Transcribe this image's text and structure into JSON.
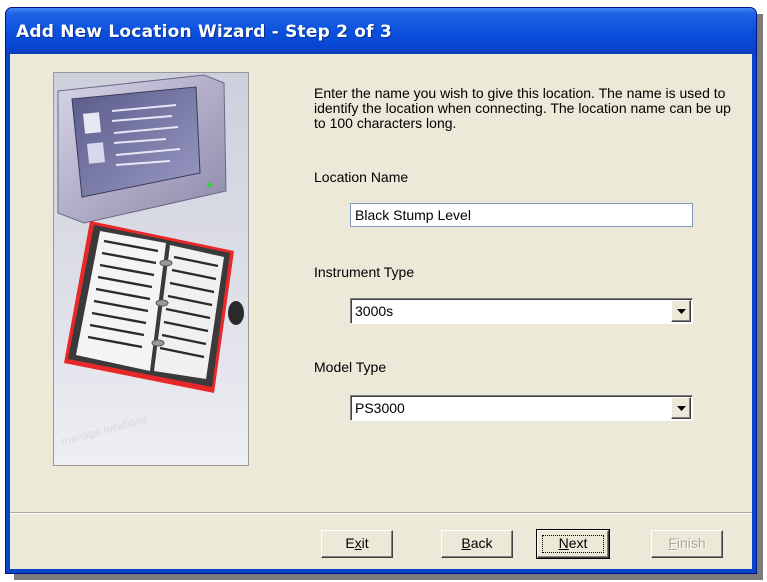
{
  "window": {
    "title": "Add New Location Wizard - Step 2 of 3",
    "colors": {
      "titlebar": "#0a4fdc",
      "client": "#ece9d8",
      "art_accent": "#e02020"
    }
  },
  "description": "Enter the name you wish to give this location. The name is used to identify the location when connecting.  The location name can be up to 100 characters long.",
  "fields": {
    "location_name": {
      "label": "Location Name",
      "value": "Black Stump Level"
    },
    "instrument_type": {
      "label": "Instrument Type",
      "value": "3000s"
    },
    "model_type": {
      "label": "Model Type",
      "value": "PS3000"
    }
  },
  "buttons": {
    "exit": {
      "pre": "E",
      "key": "x",
      "post": "it"
    },
    "back": {
      "pre": "",
      "key": "B",
      "post": "ack"
    },
    "next": {
      "pre": "",
      "key": "N",
      "post": "ext"
    },
    "finish": {
      "pre": "",
      "key": "F",
      "post": "inish"
    }
  },
  "icons": [
    "dropdown-arrow-icon",
    "computer-monitor-illustration",
    "address-book-illustration"
  ]
}
